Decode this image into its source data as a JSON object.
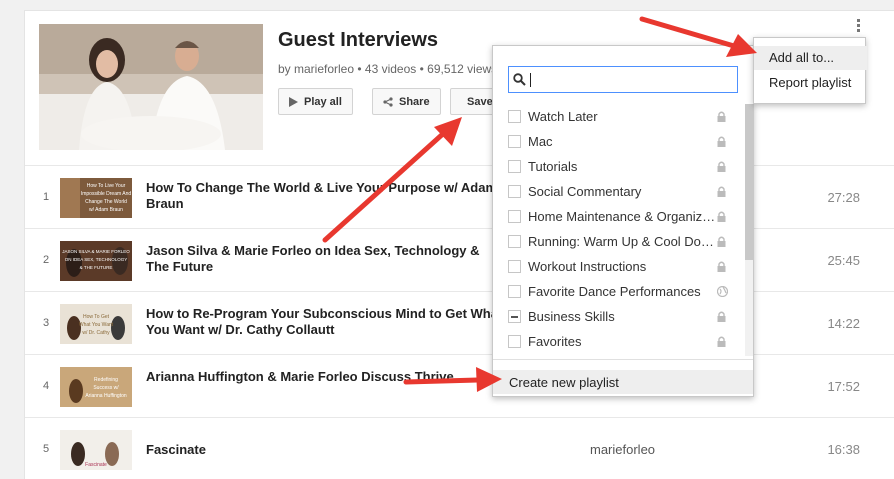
{
  "playlist": {
    "title": "Guest Interviews",
    "meta": "by marieforleo • 43 videos • 69,512 views"
  },
  "actions": {
    "play_all": "Play all",
    "share": "Share",
    "save": "Save"
  },
  "videos": [
    {
      "index": "1",
      "title": "How To Change The World & Live Your Purpose w/ Adam Braun",
      "owner": "",
      "duration": "27:28",
      "thumb_text": [
        "How To Live Your",
        "Impossible Dream And",
        "Change The World",
        "w/ Adam Braun"
      ]
    },
    {
      "index": "2",
      "title": "Jason Silva & Marie Forleo on Idea Sex, Technology & The Future",
      "owner": "",
      "duration": "25:45",
      "thumb_text": [
        "JASON SILVA & MARIE FORLEO",
        "ON IDEA SEX, TECHNOLOGY",
        "& THE FUTURE"
      ]
    },
    {
      "index": "3",
      "title": "How to Re-Program Your Subconscious Mind to Get What You Want w/ Dr. Cathy Collautt",
      "owner": "",
      "duration": "14:22",
      "thumb_text": [
        "How To Get",
        "What You Want",
        "w/ Dr. Cathy"
      ]
    },
    {
      "index": "4",
      "title": "Arianna Huffington & Marie Forleo Discuss Thrive",
      "owner": "",
      "duration": "17:52",
      "thumb_text": [
        "Redefining",
        "Success w/",
        "Arianna Huffington"
      ]
    },
    {
      "index": "5",
      "title": "Fascinate",
      "owner": "marieforleo",
      "duration": "16:38",
      "thumb_text": [
        "Fascinate"
      ]
    }
  ],
  "dropdown": {
    "search_value": "",
    "playlists": [
      {
        "name": "Watch Later",
        "privacy": "lock-icon",
        "checked": false
      },
      {
        "name": "Mac",
        "privacy": "lock-icon",
        "checked": false
      },
      {
        "name": "Tutorials",
        "privacy": "lock-icon",
        "checked": false
      },
      {
        "name": "Social Commentary",
        "privacy": "lock-icon",
        "checked": false
      },
      {
        "name": "Home Maintenance & Organization",
        "privacy": "lock-icon",
        "checked": false
      },
      {
        "name": "Running: Warm Up & Cool Down",
        "privacy": "lock-icon",
        "checked": false
      },
      {
        "name": "Workout Instructions",
        "privacy": "lock-icon",
        "checked": false
      },
      {
        "name": "Favorite Dance Performances",
        "privacy": "globe-icon",
        "checked": false
      },
      {
        "name": "Business Skills",
        "privacy": "lock-icon",
        "checked": "mixed"
      },
      {
        "name": "Favorites",
        "privacy": "lock-icon",
        "checked": false
      }
    ],
    "create_label": "Create new playlist"
  },
  "menu": {
    "add_all": "Add all to...",
    "report": "Report playlist"
  },
  "colors": {
    "arrow": "#e8382f",
    "search_focus": "#4d90fe"
  }
}
